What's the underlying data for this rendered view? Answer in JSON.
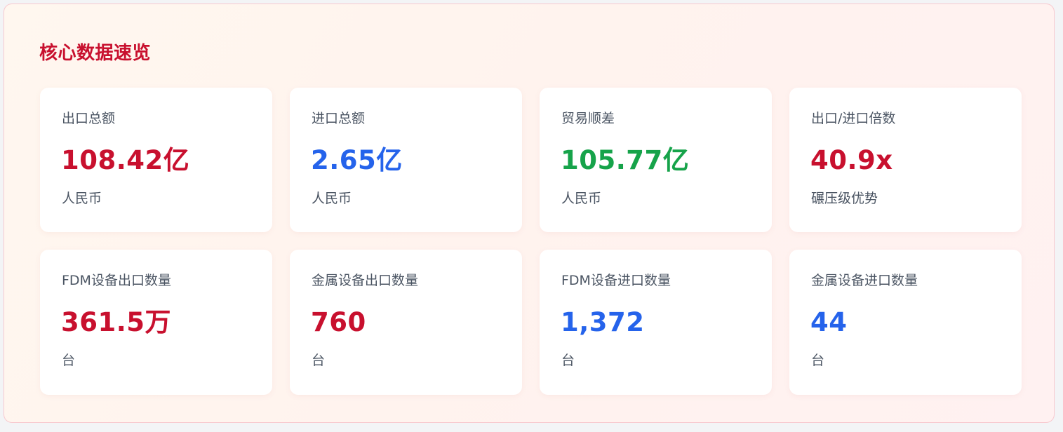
{
  "panel": {
    "title": "核心数据速览"
  },
  "colors": {
    "red": "#c8102e",
    "blue": "#2563eb",
    "green": "#16a34a"
  },
  "cards": [
    {
      "label": "出口总额",
      "value": "108.42亿",
      "unit": "人民币",
      "color": "red"
    },
    {
      "label": "进口总额",
      "value": "2.65亿",
      "unit": "人民币",
      "color": "blue"
    },
    {
      "label": "贸易顺差",
      "value": "105.77亿",
      "unit": "人民币",
      "color": "green"
    },
    {
      "label": "出口/进口倍数",
      "value": "40.9x",
      "unit": "碾压级优势",
      "color": "red"
    },
    {
      "label": "FDM设备出口数量",
      "value": "361.5万",
      "unit": "台",
      "color": "red"
    },
    {
      "label": "金属设备出口数量",
      "value": "760",
      "unit": "台",
      "color": "red"
    },
    {
      "label": "FDM设备进口数量",
      "value": "1,372",
      "unit": "台",
      "color": "blue"
    },
    {
      "label": "金属设备进口数量",
      "value": "44",
      "unit": "台",
      "color": "blue"
    }
  ]
}
